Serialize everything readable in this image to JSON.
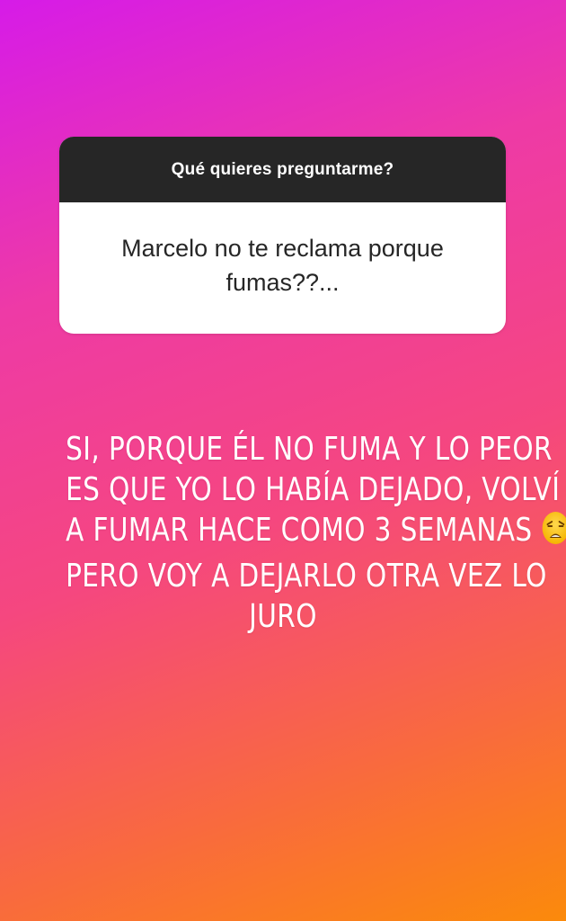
{
  "question_sticker": {
    "prompt": "Qué quieres preguntarme?",
    "question": "Marcelo no te reclama porque fumas??..."
  },
  "answer": {
    "lines": [
      "SI, PORQUE ÉL NO FUMA Y LO PEOR",
      "ES QUE YO LO HABÍA DEJADO, VOLVÍ",
      "A FUMAR HACE COMO 3 SEMANAS",
      "PERO VOY A DEJARLO OTRA VEZ LO",
      "JURO"
    ],
    "emoji": "weary-face-emoji"
  },
  "colors": {
    "gradient_start": "#d61be8",
    "gradient_mid": "#f5477f",
    "gradient_end": "#fb8a0b",
    "header_bg": "#262626",
    "card_bg": "#ffffff"
  }
}
